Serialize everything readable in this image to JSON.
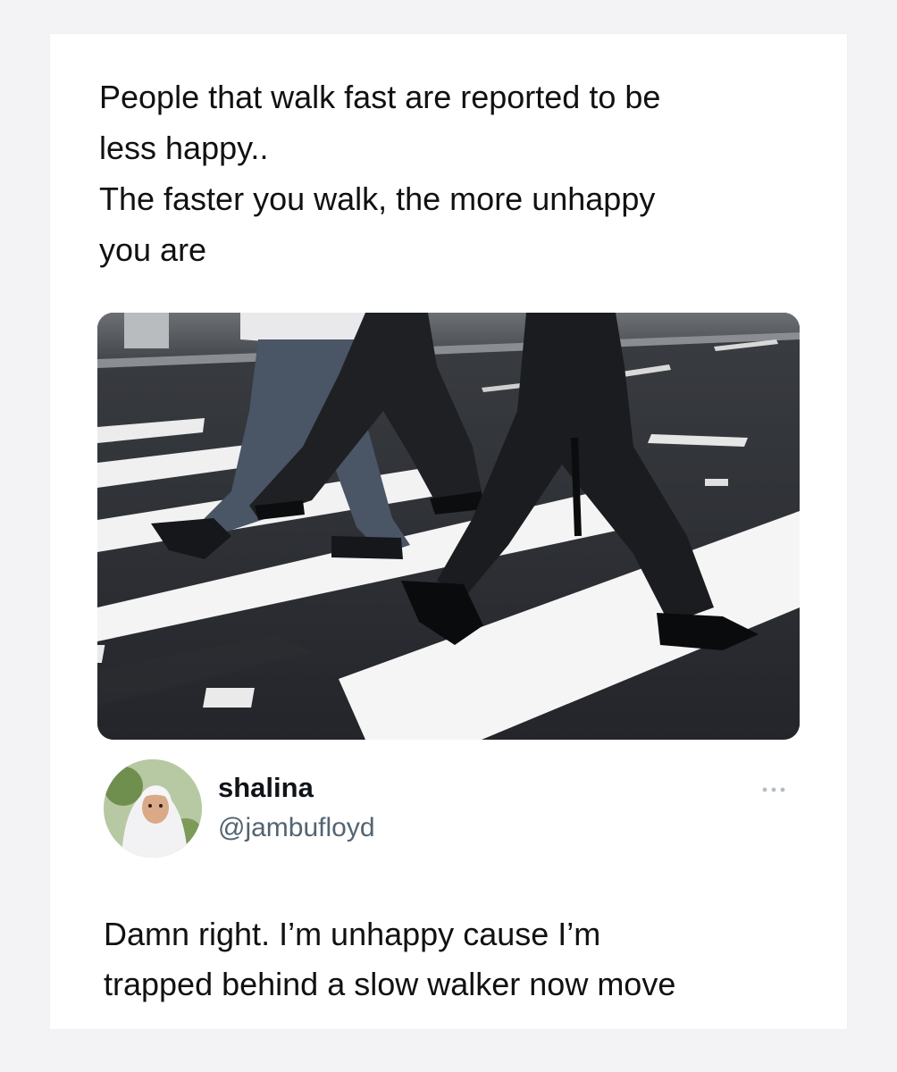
{
  "quoted_post": {
    "lines": [
      "People that walk fast are reported to be",
      "less happy..",
      "The faster you walk, the more unhappy",
      "you are"
    ]
  },
  "media": {
    "icon": "photo-people-walking-crosswalk"
  },
  "reply": {
    "author": {
      "display_name": "shalina",
      "handle": "@jambufloyd",
      "avatar_icon": "user-avatar"
    },
    "more_icon": "more-horizontal-icon",
    "lines": [
      "Damn right. I’m unhappy cause I’m",
      "trapped behind a slow walker now move"
    ]
  }
}
